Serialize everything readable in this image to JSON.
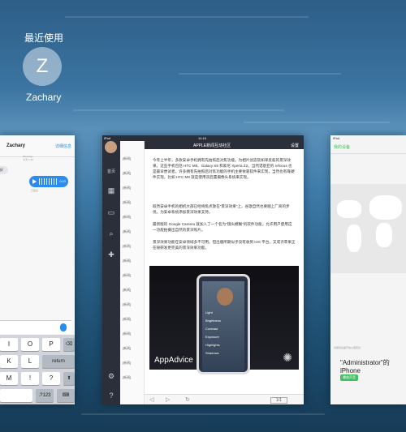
{
  "switcher": {
    "recent_label": "最近使用",
    "contact": {
      "initial": "Z",
      "name": "Zachary"
    }
  },
  "messages_card": {
    "title": "Zachary",
    "details": "详细信息",
    "meta": [
      "iMessage",
      "今天 1:40"
    ],
    "in_bubble": "好",
    "voice_duration": "0:03",
    "out_label": "已送达",
    "keys_row1": [
      "I",
      "O",
      "P"
    ],
    "keys_row2": [
      "K",
      "L",
      "return"
    ],
    "keys_row3": [
      "M",
      "!",
      "?"
    ],
    "keys_row4": [
      ".?123"
    ]
  },
  "tweet_card": {
    "status_left": "iPad",
    "status_time": "14:16",
    "top_title": "APPLE新闻互动社区",
    "top_right": "设置",
    "side_label": "首页",
    "list_rows": [
      "[新闻]",
      "[新闻]",
      "[新闻]",
      "[新闻]",
      "[新闻]",
      "[新闻]",
      "[新闻]",
      "[新闻]",
      "[新闻]",
      "[新闻]",
      "[新闻]",
      "[新闻]",
      "[新闻]",
      "[新闻]",
      "[新闻]",
      "[新闻]"
    ],
    "paragraphs": [
      "今年上半年，多款安卓手机拥有先拍照后对焦功能。为相片创造软如单反般的景深效果。这些手机包括 HTC M8、Galaxy S5 和索尼 Xperia Z2。当然诺基亚的 refocus 也是最早尝试者。许多拥有先拍照后对焦功能的手机主要依靠软件来实现，当然也有靠硬件实现，比如 HTC M8 就是使用双后置摄像头系统来实现。",
      "既然安卓手机的相机大部已经将焦点放在\"景深效果\"上，谷歌自然也要顺上厂商的步伐，为安卓系统添加景深效果支持。",
      "最新版的 Google Camera 就加入了一个名为\"镜头模糊\"的软件功能，允许用户使用这一功能拍摄出自然的景深照片。",
      "景深效果功能在安卓领域多不可用。但出版所期似乎没有收到 iOS 平台，又或许苹果正在秘研发更完美的景深效果功能。"
    ],
    "image_menu": [
      "Light",
      "Brightness",
      "Contrast",
      "Exposure",
      "Highlights",
      "Shadows"
    ],
    "image_brand": "AppAdvice",
    "page_indicator": "1/1"
  },
  "settings_card": {
    "status": "iPad",
    "header": "我的设备",
    "note": "请保持设备开启以便定位",
    "device_name": "\"Administrator\"的 iPhone",
    "device_sub": "离线",
    "button": "播放声音"
  },
  "colors": {
    "accent_blue": "#2a8cf0",
    "accent_green": "#3fbf5e",
    "sidebar_dark": "#2b2f3a"
  }
}
